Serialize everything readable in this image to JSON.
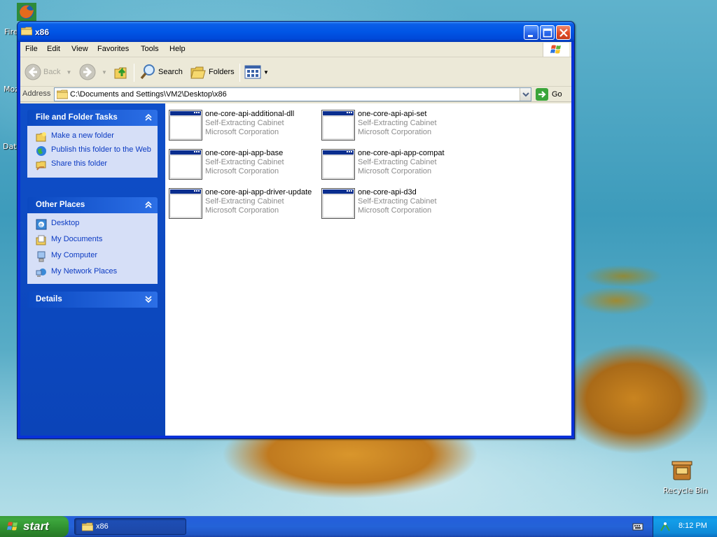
{
  "desktop": {
    "icons": [
      {
        "label": "Fire"
      },
      {
        "label": "Moz"
      },
      {
        "label": "Dat"
      },
      {
        "label": "Recycle Bin"
      }
    ]
  },
  "window": {
    "title": "x86",
    "menu": [
      "File",
      "Edit",
      "View",
      "Favorites",
      "Tools",
      "Help"
    ],
    "toolbar": {
      "back": "Back",
      "search": "Search",
      "folders": "Folders"
    },
    "address": {
      "label": "Address",
      "value": "C:\\Documents and Settings\\VM2\\Desktop\\x86",
      "go": "Go"
    },
    "panels": {
      "file_tasks": {
        "title": "File and Folder Tasks",
        "items": [
          "Make a new folder",
          "Publish this folder to the Web",
          "Share this folder"
        ]
      },
      "other_places": {
        "title": "Other Places",
        "items": [
          "Desktop",
          "My Documents",
          "My Computer",
          "My Network Places"
        ]
      },
      "details": {
        "title": "Details"
      }
    },
    "files": [
      {
        "name": "one-core-api-additional-dll",
        "type": "Self-Extracting Cabinet",
        "company": "Microsoft Corporation"
      },
      {
        "name": "one-core-api-api-set",
        "type": "Self-Extracting Cabinet",
        "company": "Microsoft Corporation"
      },
      {
        "name": "one-core-api-app-base",
        "type": "Self-Extracting Cabinet",
        "company": "Microsoft Corporation"
      },
      {
        "name": "one-core-api-app-compat",
        "type": "Self-Extracting Cabinet",
        "company": "Microsoft Corporation"
      },
      {
        "name": "one-core-api-app-driver-update",
        "type": "Self-Extracting Cabinet",
        "company": "Microsoft Corporation"
      },
      {
        "name": "one-core-api-d3d",
        "type": "Self-Extracting Cabinet",
        "company": "Microsoft Corporation"
      }
    ]
  },
  "taskbar": {
    "start": "start",
    "task_button": "x86",
    "clock": "8:12 PM"
  },
  "colors": {
    "title_blue": "#0055e5",
    "task_pane_blue": "#0f4fc9",
    "link_blue": "#0b3ac2",
    "start_green": "#3ea83e"
  }
}
